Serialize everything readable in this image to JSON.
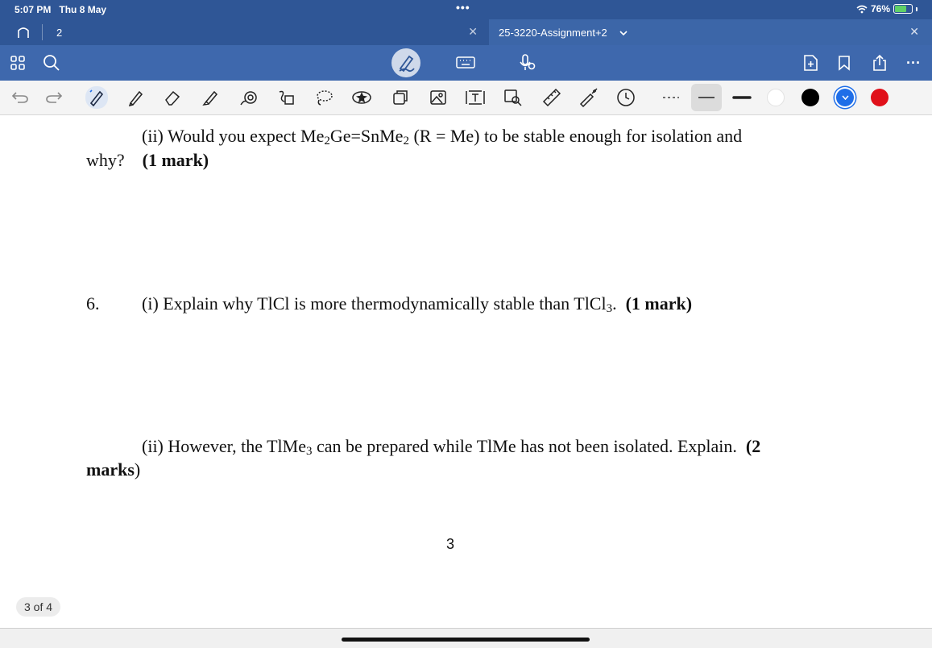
{
  "status_bar": {
    "time": "5:07 PM",
    "date": "Thu 8 May",
    "battery": "76%",
    "battery_level": 0.76,
    "multitask_dots": "•••"
  },
  "tabs": [
    {
      "label": "2",
      "active": false
    },
    {
      "label": "25-3220-Assignment+2",
      "active": true
    }
  ],
  "toolbar_icons": [
    "grid-icon",
    "search-icon",
    "pen-mode-icon",
    "keyboard-icon",
    "dictate-icon",
    "add-page-icon",
    "bookmark-icon",
    "share-icon",
    "more-icon"
  ],
  "draw_tools": [
    "undo",
    "redo",
    "pen",
    "pencil",
    "eraser",
    "highlighter",
    "shape",
    "lasso-text",
    "lasso",
    "sticker",
    "element",
    "image",
    "text",
    "scan",
    "ruler",
    "laser-pointer",
    "timer"
  ],
  "colors": {
    "chrome": "#2f5696",
    "toolbar": "#3e68ad",
    "swatches": [
      "#ffffff",
      "#000000",
      "#1f6ee8",
      "#e0101a"
    ]
  },
  "document": {
    "q5ii_line1": {
      "pre": "(ii) Would you expect Me",
      "s1": "2",
      "mid1": "Ge=SnMe",
      "s2": "2",
      "post": " (R = Me) to be stable enough for isolation and"
    },
    "q5ii_line2": {
      "text": "why?",
      "mark": "(1 mark)"
    },
    "q6_number": "6.",
    "q6i": {
      "pre": "(i) Explain why TlCl is more thermodynamically stable than TlCl",
      "s": "3",
      "post": ".",
      "mark": "(1 mark)"
    },
    "q6ii_line1": {
      "pre": "(ii) However, the TlMe",
      "s": "3",
      "post": " can be prepared while TlMe has not been isolated. Explain.",
      "mark": "(2"
    },
    "q6ii_line2": {
      "mark": "marks",
      "paren": ")"
    },
    "page_number": "3",
    "page_indicator": "3 of 4"
  }
}
